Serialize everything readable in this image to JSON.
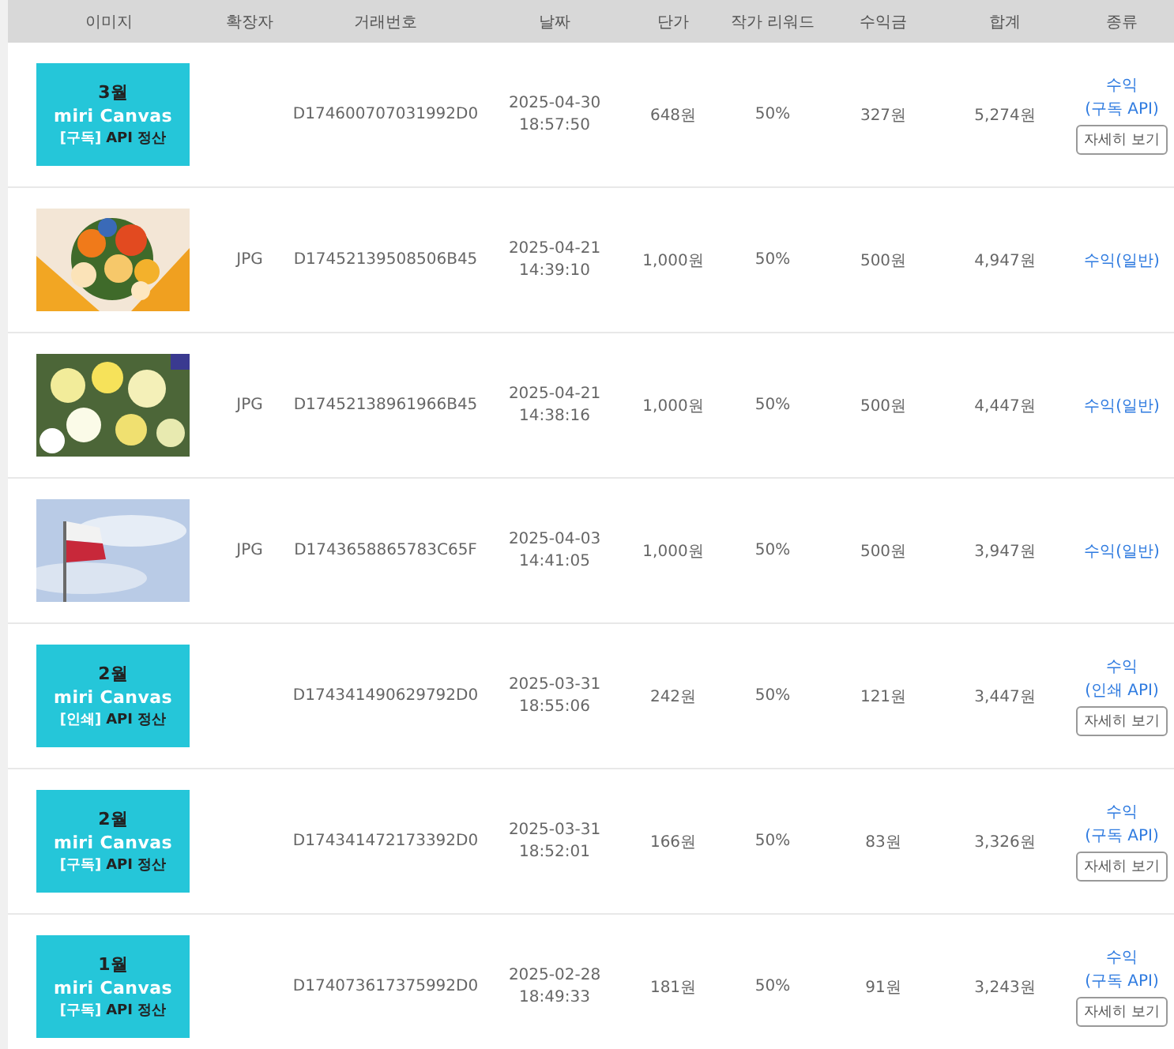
{
  "table": {
    "columns": [
      "이미지",
      "확장자",
      "거래번호",
      "날짜",
      "단가",
      "작가 리워드",
      "수익금",
      "합계",
      "종류"
    ],
    "rows": [
      {
        "image": {
          "kind": "banner",
          "month": "3월",
          "logo": "miri Canvas",
          "tag": "[구독]",
          "caption": "API 정산"
        },
        "transaction": "D174600707031992D0",
        "date": "2025-04-30",
        "time": "18:57:50",
        "price": "648원",
        "reward": "50%",
        "earning": "327원",
        "total": "5,274원",
        "type": {
          "kind": "api",
          "label": "수익",
          "sub": "(구독 API)",
          "button": "자세히 보기"
        }
      },
      {
        "extension": "JPG",
        "transaction": "D17452139508506B45",
        "date": "2025-04-21",
        "time": "14:39:10",
        "price": "1,000원",
        "reward": "50%",
        "earning": "500원",
        "total": "4,947원",
        "type": {
          "kind": "general",
          "label": "수익(일반)"
        }
      },
      {
        "extension": "JPG",
        "transaction": "D17452138961966B45",
        "date": "2025-04-21",
        "time": "14:38:16",
        "price": "1,000원",
        "reward": "50%",
        "earning": "500원",
        "total": "4,447원",
        "type": {
          "kind": "general",
          "label": "수익(일반)"
        }
      },
      {
        "extension": "JPG",
        "transaction": "D1743658865783C65F",
        "date": "2025-04-03",
        "time": "14:41:05",
        "price": "1,000원",
        "reward": "50%",
        "earning": "500원",
        "total": "3,947원",
        "type": {
          "kind": "general",
          "label": "수익(일반)"
        }
      },
      {
        "image": {
          "kind": "banner",
          "month": "2월",
          "logo": "miri Canvas",
          "tag": "[인쇄]",
          "caption": "API 정산"
        },
        "transaction": "D174341490629792D0",
        "date": "2025-03-31",
        "time": "18:55:06",
        "price": "242원",
        "reward": "50%",
        "earning": "121원",
        "total": "3,447원",
        "type": {
          "kind": "api",
          "label": "수익",
          "sub": "(인쇄 API)",
          "button": "자세히 보기"
        }
      },
      {
        "image": {
          "kind": "banner",
          "month": "2월",
          "logo": "miri Canvas",
          "tag": "[구독]",
          "caption": "API 정산"
        },
        "transaction": "D174341472173392D0",
        "date": "2025-03-31",
        "time": "18:52:01",
        "price": "166원",
        "reward": "50%",
        "earning": "83원",
        "total": "3,326원",
        "type": {
          "kind": "api",
          "label": "수익",
          "sub": "(구독 API)",
          "button": "자세히 보기"
        }
      },
      {
        "image": {
          "kind": "banner",
          "month": "1월",
          "logo": "miri Canvas",
          "tag": "[구독]",
          "caption": "API 정산"
        },
        "transaction": "D174073617375992D0",
        "date": "2025-02-28",
        "time": "18:49:33",
        "price": "181원",
        "reward": "50%",
        "earning": "91원",
        "total": "3,243원",
        "type": {
          "kind": "api",
          "label": "수익",
          "sub": "(구독 API)",
          "button": "자세히 보기"
        }
      }
    ]
  }
}
